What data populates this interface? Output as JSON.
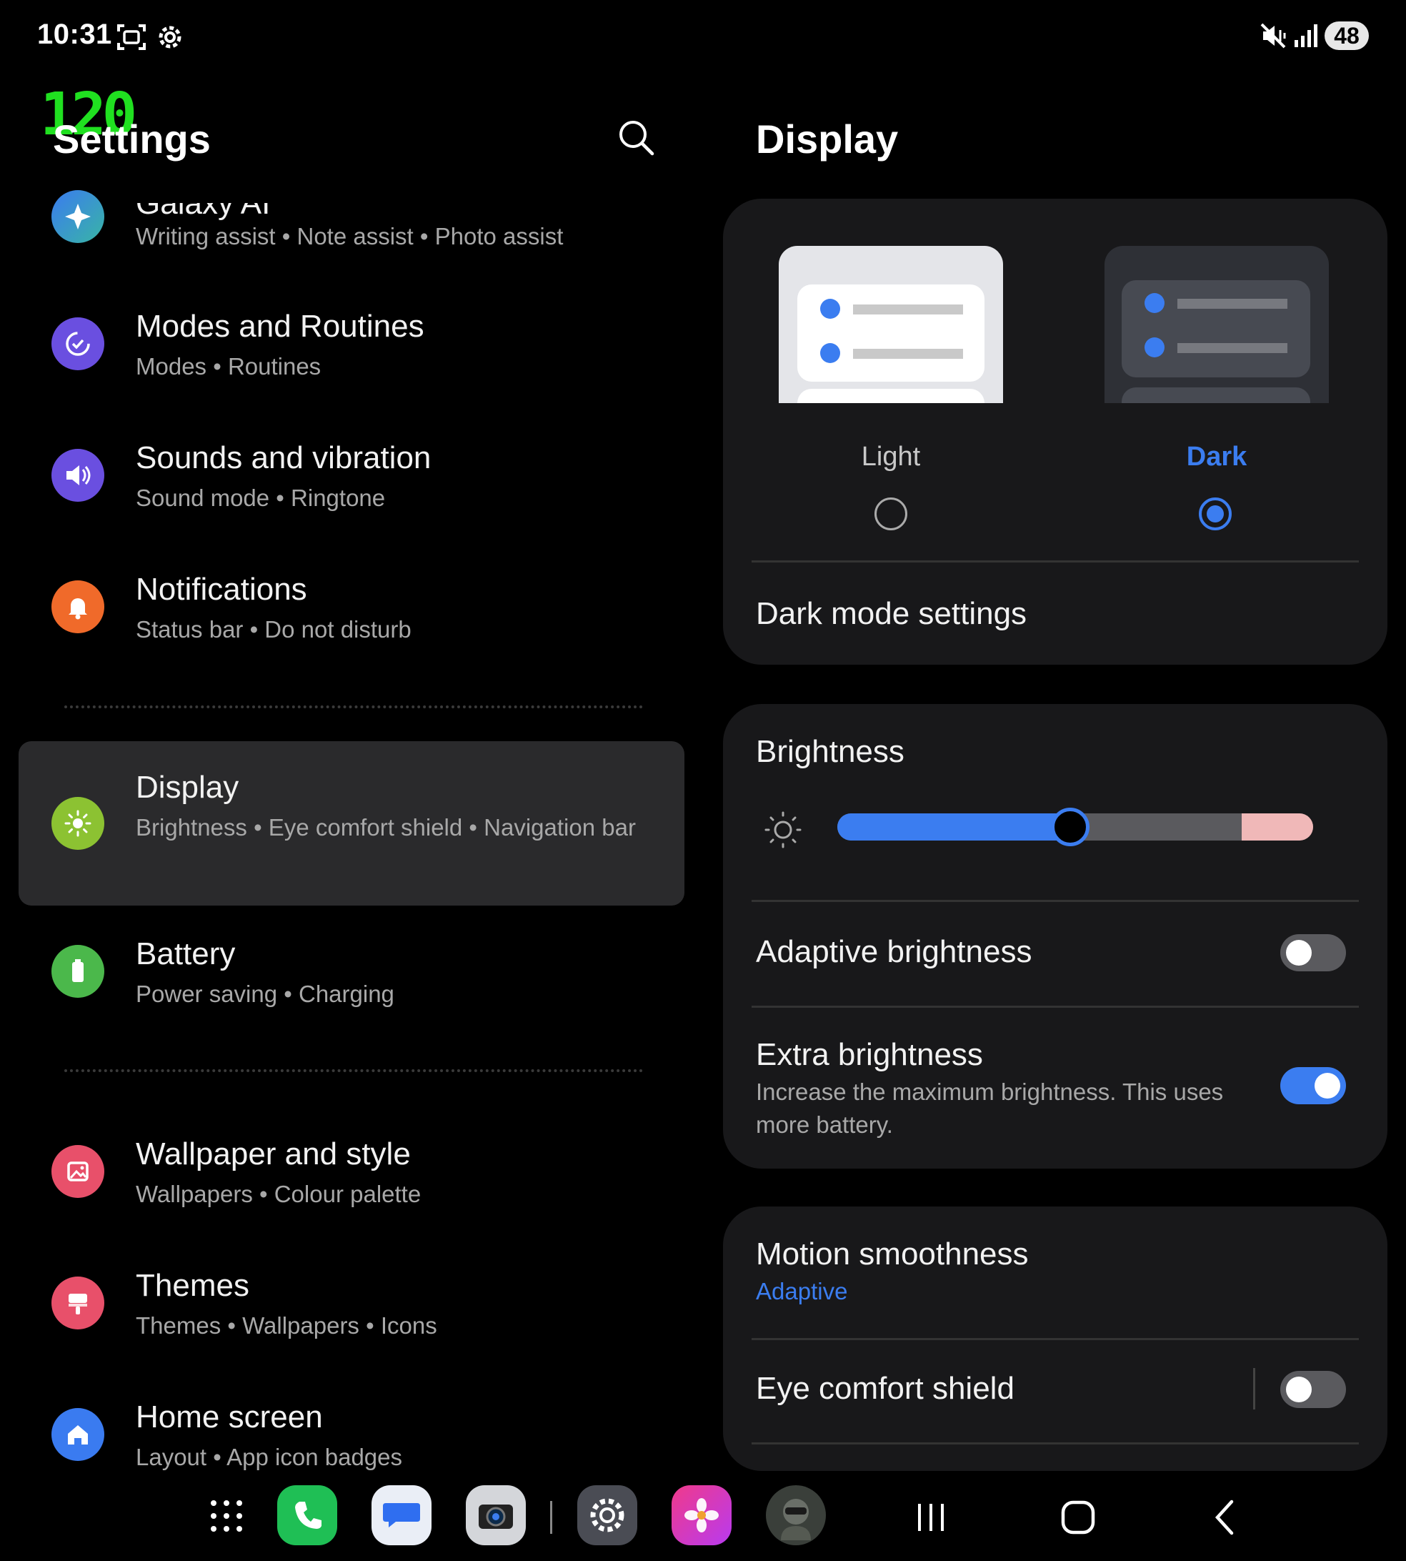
{
  "status_bar": {
    "time": "10:31",
    "battery": "48",
    "fps_overlay": "120"
  },
  "left_panel": {
    "title": "Settings",
    "items": [
      {
        "title": "Galaxy AI",
        "subtitle": "Writing assist  •  Note assist  •  Photo assist",
        "icon": "galaxy-ai-icon",
        "color": "#3a7bf0"
      },
      {
        "title": "Modes and Routines",
        "subtitle": "Modes  •  Routines",
        "icon": "modes-routines-icon",
        "color": "#6a4fe0"
      },
      {
        "title": "Sounds and vibration",
        "subtitle": "Sound mode  •  Ringtone",
        "icon": "speaker-icon",
        "color": "#6a4fe0"
      },
      {
        "title": "Notifications",
        "subtitle": "Status bar  •  Do not disturb",
        "icon": "bell-icon",
        "color": "#f06a2a"
      },
      {
        "title": "Display",
        "subtitle": "Brightness  •  Eye comfort shield  •  Navigation bar",
        "icon": "sun-icon",
        "color": "#8cc232"
      },
      {
        "title": "Battery",
        "subtitle": "Power saving  •  Charging",
        "icon": "battery-icon",
        "color": "#4bb84b"
      },
      {
        "title": "Wallpaper and style",
        "subtitle": "Wallpapers  •  Colour palette",
        "icon": "wallpaper-icon",
        "color": "#e8506a"
      },
      {
        "title": "Themes",
        "subtitle": "Themes  •  Wallpapers  •  Icons",
        "icon": "themes-icon",
        "color": "#e8506a"
      },
      {
        "title": "Home screen",
        "subtitle": "Layout  •  App icon badges",
        "icon": "home-icon",
        "color": "#3a7bf0"
      }
    ]
  },
  "right_panel": {
    "title": "Display",
    "theme": {
      "light_label": "Light",
      "dark_label": "Dark",
      "selected": "Dark",
      "dark_mode_settings": "Dark mode settings"
    },
    "brightness": {
      "label": "Brightness",
      "level": 0.49,
      "extra_segment_start": 0.85
    },
    "adaptive_brightness": {
      "label": "Adaptive brightness",
      "on": false
    },
    "extra_brightness": {
      "label": "Extra brightness",
      "description": "Increase the maximum brightness. This uses more battery.",
      "on": true
    },
    "motion_smoothness": {
      "label": "Motion smoothness",
      "value": "Adaptive"
    },
    "eye_comfort_shield": {
      "label": "Eye comfort shield",
      "on": false
    }
  },
  "accent_color": "#3b7df0",
  "dock": {
    "apps": [
      "apps-grid-icon",
      "phone-icon",
      "messages-icon",
      "camera-icon",
      "settings-icon",
      "gallery-icon",
      "game-icon"
    ],
    "nav": [
      "recents-icon",
      "home-nav-icon",
      "back-icon"
    ]
  }
}
